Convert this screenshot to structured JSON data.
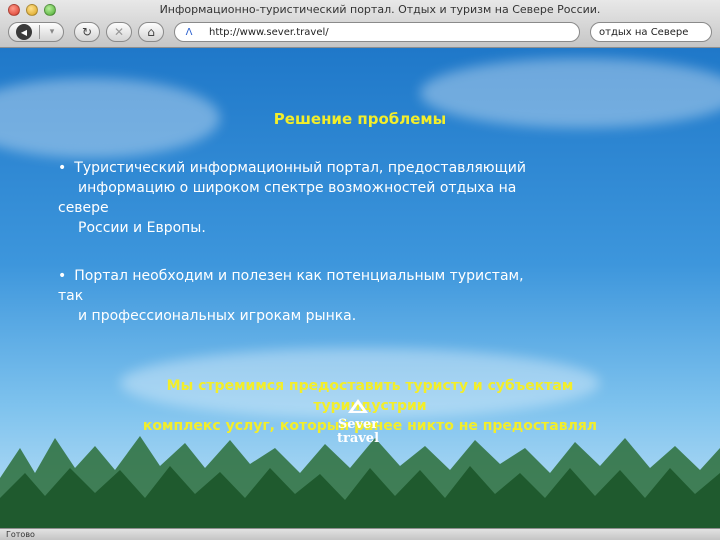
{
  "window": {
    "title": "Информационно-туристический портал. Отдых и туризм на Севере России."
  },
  "toolbar": {
    "url": "http://www.sever.travel/",
    "search_value": "отдых на Севере"
  },
  "icons": {
    "back": "back-arrow-icon",
    "forward": "forward-arrow-icon",
    "reload": "reload-icon",
    "stop": "stop-icon",
    "home": "home-icon",
    "site": "site-favicon"
  },
  "slide": {
    "title": "Решение проблемы",
    "bullets": [
      {
        "lines": [
          "Туристический информационный портал, предоставляющий",
          "информацию о широком спектре возможностей отдыха на",
          "севере",
          "России и Европы."
        ]
      },
      {
        "lines": [
          "Портал необходим и полезен как потенциальным туристам,",
          "так",
          "и профессиональных игрокам рынка."
        ]
      }
    ],
    "tagline": [
      "Мы стремимся предоставить туристу и субъектам",
      "туриндустрии",
      "комплекс услуг, который ранее никто не предоставлял"
    ],
    "logo": [
      "Sever",
      "travel"
    ]
  },
  "status": {
    "text": "Готово"
  },
  "colors": {
    "accent_yellow": "#f3ee2a",
    "sky_top": "#1f78c9",
    "sky_bottom": "#bfe1f6",
    "forest": "#1f5a2e"
  }
}
